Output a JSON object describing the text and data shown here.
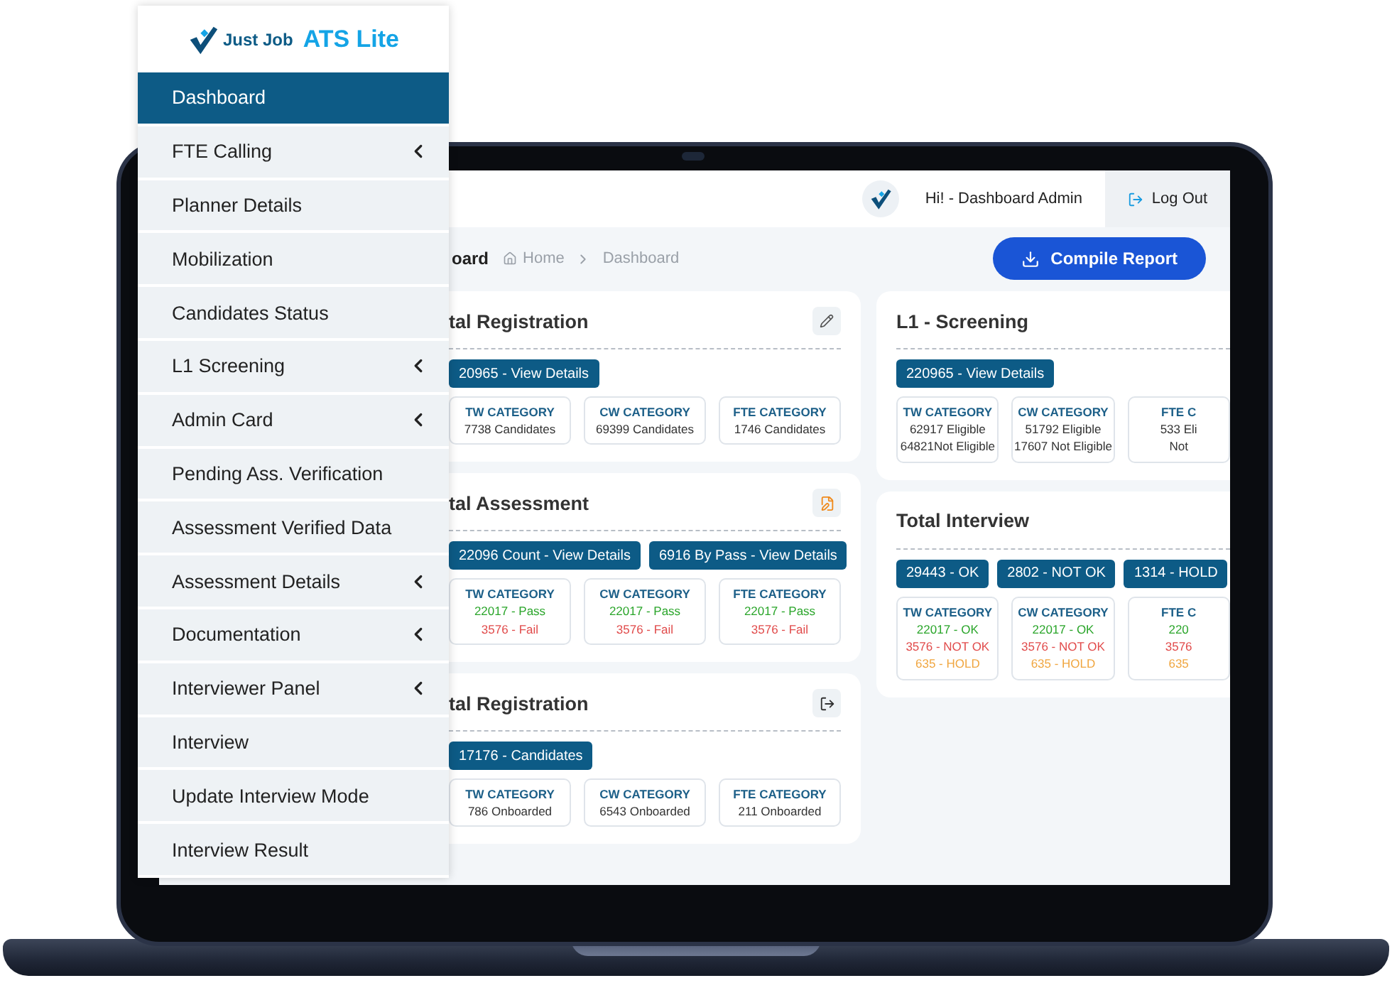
{
  "sidebar": {
    "logo": {
      "brand": "Just Job",
      "product": "ATS Lite"
    },
    "items": [
      {
        "label": "Dashboard",
        "selected": true,
        "submenu": false
      },
      {
        "label": "FTE Calling",
        "selected": false,
        "submenu": true
      },
      {
        "label": "Planner Details",
        "selected": false,
        "submenu": false
      },
      {
        "label": "Mobilization",
        "selected": false,
        "submenu": false
      },
      {
        "label": "Candidates Status",
        "selected": false,
        "submenu": false
      },
      {
        "label": "L1 Screening",
        "selected": false,
        "submenu": true
      },
      {
        "label": "Admin Card",
        "selected": false,
        "submenu": true
      },
      {
        "label": "Pending Ass. Verification",
        "selected": false,
        "submenu": false
      },
      {
        "label": "Assessment Verified Data",
        "selected": false,
        "submenu": false
      },
      {
        "label": "Assessment Details",
        "selected": false,
        "submenu": true
      },
      {
        "label": "Documentation",
        "selected": false,
        "submenu": true
      },
      {
        "label": "Interviewer Panel",
        "selected": false,
        "submenu": true
      },
      {
        "label": "Interview",
        "selected": false,
        "submenu": false
      },
      {
        "label": "Update Interview Mode",
        "selected": false,
        "submenu": false
      },
      {
        "label": "Interview Result",
        "selected": false,
        "submenu": false
      }
    ]
  },
  "topbar": {
    "greeting": "Hi! - Dashboard Admin",
    "logout": "Log Out"
  },
  "breadcrumb": {
    "page_title": "oard",
    "home": "Home",
    "current": "Dashboard"
  },
  "compile_button": "Compile Report",
  "columns": [
    {
      "cards": [
        {
          "title": "tal Registration",
          "kind": "edit",
          "chips": [
            "20965 - View Details"
          ],
          "categories": [
            {
              "name": "TW CATEGORY",
              "lines": [
                {
                  "text": "7738 Candidates",
                  "kind": "plain"
                }
              ]
            },
            {
              "name": "CW CATEGORY",
              "lines": [
                {
                  "text": "69399 Candidates",
                  "kind": "plain"
                }
              ]
            },
            {
              "name": "FTE CATEGORY",
              "lines": [
                {
                  "text": "1746 Candidates",
                  "kind": "plain"
                }
              ]
            }
          ]
        },
        {
          "title": "tal Assessment",
          "kind": "document",
          "chips": [
            "22096 Count - View Details",
            "6916 By Pass - View Details"
          ],
          "categories": [
            {
              "name": "TW CATEGORY",
              "lines": [
                {
                  "text": "22017 - Pass",
                  "kind": "pass"
                },
                {
                  "text": "3576 - Fail",
                  "kind": "fail"
                }
              ]
            },
            {
              "name": "CW CATEGORY",
              "lines": [
                {
                  "text": "22017 - Pass",
                  "kind": "pass"
                },
                {
                  "text": "3576 - Fail",
                  "kind": "fail"
                }
              ]
            },
            {
              "name": "FTE CATEGORY",
              "lines": [
                {
                  "text": "22017 - Pass",
                  "kind": "pass"
                },
                {
                  "text": "3576 - Fail",
                  "kind": "fail"
                }
              ]
            }
          ]
        },
        {
          "title": "tal Registration",
          "kind": "exit",
          "chips": [
            "17176 - Candidates"
          ],
          "categories": [
            {
              "name": "TW CATEGORY",
              "lines": [
                {
                  "text": "786 Onboarded",
                  "kind": "plain"
                }
              ]
            },
            {
              "name": "CW CATEGORY",
              "lines": [
                {
                  "text": "6543 Onboarded",
                  "kind": "plain"
                }
              ]
            },
            {
              "name": "FTE CATEGORY",
              "lines": [
                {
                  "text": "211 Onboarded",
                  "kind": "plain"
                }
              ]
            }
          ]
        }
      ]
    },
    {
      "cards": [
        {
          "title": "L1 - Screening",
          "kind": "plain",
          "chips": [
            "220965 - View Details"
          ],
          "categories": [
            {
              "name": "TW CATEGORY",
              "lines": [
                {
                  "text": "62917 Eligible",
                  "kind": "plain"
                },
                {
                  "text": "64821Not Eligible",
                  "kind": "plain"
                }
              ]
            },
            {
              "name": "CW CATEGORY",
              "lines": [
                {
                  "text": "51792 Eligible",
                  "kind": "plain"
                },
                {
                  "text": "17607 Not Eligible",
                  "kind": "plain"
                }
              ]
            },
            {
              "name": "FTE C",
              "lines": [
                {
                  "text": "533 Eli",
                  "kind": "plain"
                },
                {
                  "text": "Not",
                  "kind": "plain"
                }
              ]
            }
          ]
        },
        {
          "title": "Total Interview",
          "kind": "plain",
          "chips": [
            "29443 - OK",
            "2802 - NOT OK",
            "1314 - HOLD"
          ],
          "categories": [
            {
              "name": "TW CATEGORY",
              "lines": [
                {
                  "text": "22017 - OK",
                  "kind": "pass"
                },
                {
                  "text": "3576 - NOT OK",
                  "kind": "fail"
                },
                {
                  "text": "635 - HOLD",
                  "kind": "hold"
                }
              ]
            },
            {
              "name": "CW CATEGORY",
              "lines": [
                {
                  "text": "22017 - OK",
                  "kind": "pass"
                },
                {
                  "text": "3576 - NOT OK",
                  "kind": "fail"
                },
                {
                  "text": "635 - HOLD",
                  "kind": "hold"
                }
              ]
            },
            {
              "name": "FTE C",
              "lines": [
                {
                  "text": "220",
                  "kind": "pass"
                },
                {
                  "text": "3576",
                  "kind": "fail"
                },
                {
                  "text": "635",
                  "kind": "hold"
                }
              ]
            }
          ]
        }
      ]
    }
  ]
}
